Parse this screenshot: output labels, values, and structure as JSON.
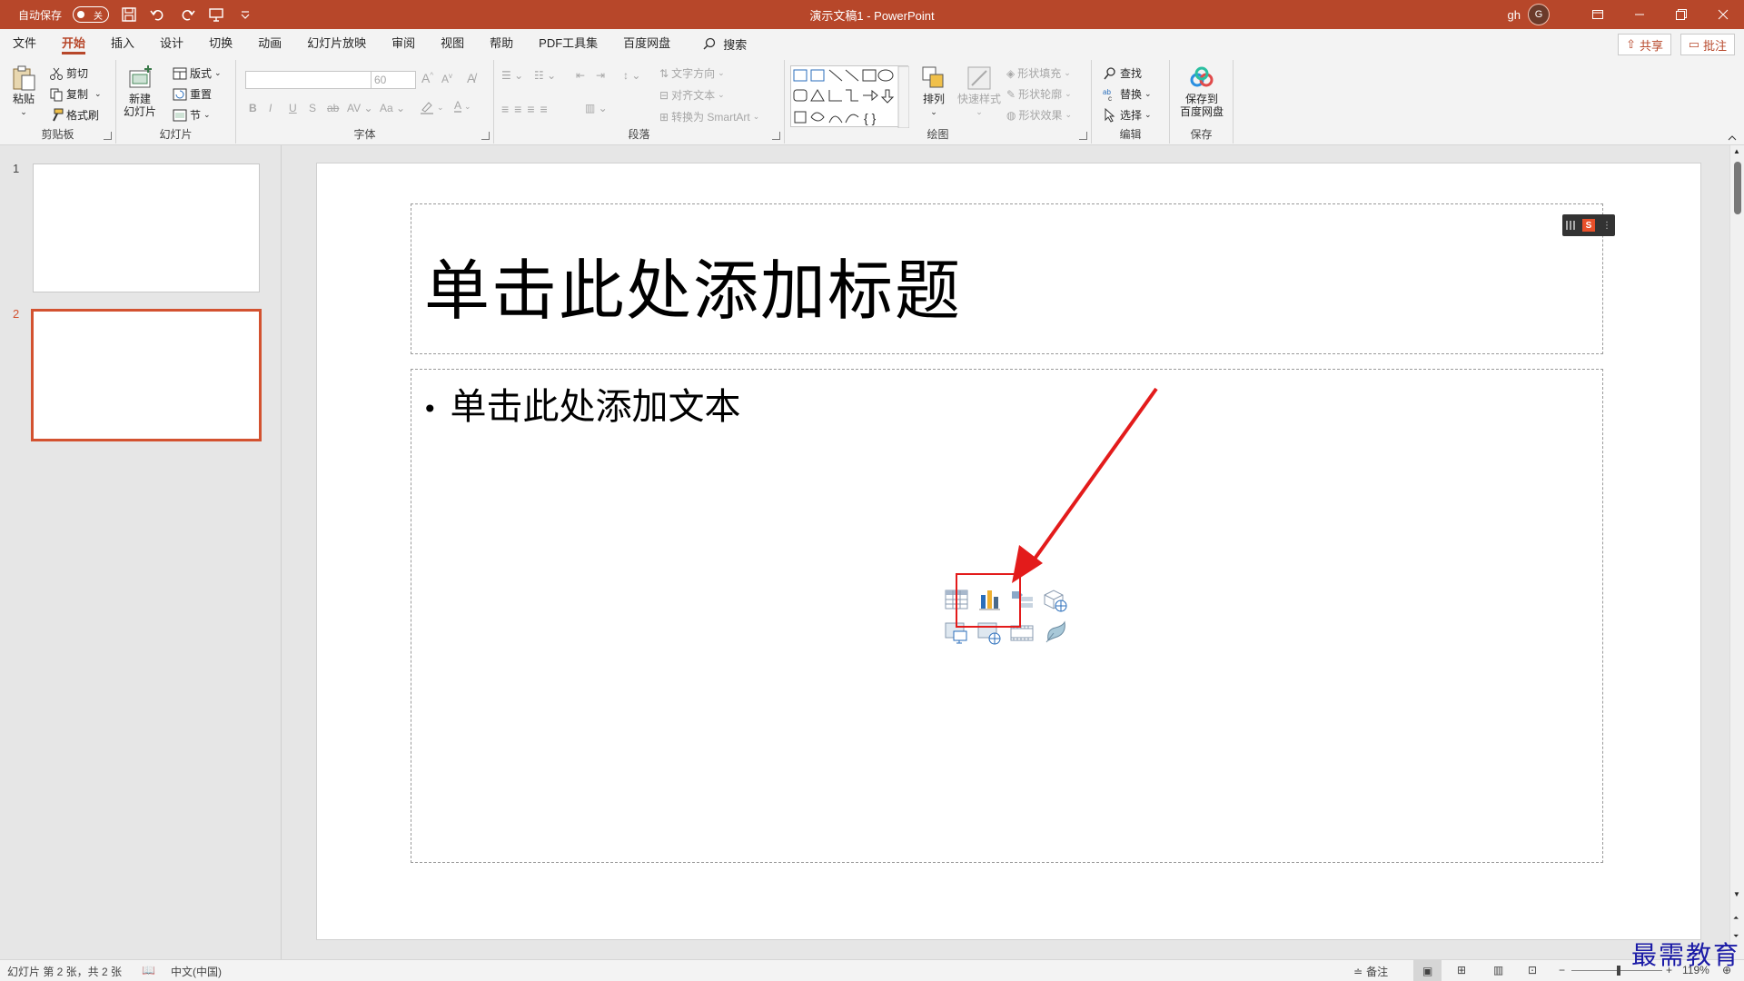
{
  "titlebar": {
    "autosave_label": "自动保存",
    "autosave_state": "关",
    "document_title": "演示文稿1  -  PowerPoint",
    "user_name": "gh",
    "avatar_initial": "G"
  },
  "tabs": [
    {
      "label": "文件",
      "active": false
    },
    {
      "label": "开始",
      "active": true
    },
    {
      "label": "插入",
      "active": false
    },
    {
      "label": "设计",
      "active": false
    },
    {
      "label": "切换",
      "active": false
    },
    {
      "label": "动画",
      "active": false
    },
    {
      "label": "幻灯片放映",
      "active": false
    },
    {
      "label": "审阅",
      "active": false
    },
    {
      "label": "视图",
      "active": false
    },
    {
      "label": "帮助",
      "active": false
    },
    {
      "label": "PDF工具集",
      "active": false
    },
    {
      "label": "百度网盘",
      "active": false
    }
  ],
  "search_label": "搜索",
  "share_label": "共享",
  "comment_label": "批注",
  "ribbon": {
    "clipboard": {
      "label": "剪贴板",
      "paste": "粘贴",
      "cut": "剪切",
      "copy": "复制",
      "format_painter": "格式刷"
    },
    "slides": {
      "label": "幻灯片",
      "new_slide_line1": "新建",
      "new_slide_line2": "幻灯片",
      "layout": "版式",
      "reset": "重置",
      "section": "节"
    },
    "font": {
      "label": "字体",
      "size": "60"
    },
    "paragraph": {
      "label": "段落",
      "text_direction": "文字方向",
      "align_text": "对齐文本",
      "convert_smartart": "转换为 SmartArt"
    },
    "drawing": {
      "label": "绘图",
      "arrange": "排列",
      "quick_styles": "快速样式",
      "shape_fill": "形状填充",
      "shape_outline": "形状轮廓",
      "shape_effects": "形状效果"
    },
    "editing": {
      "label": "编辑",
      "find": "查找",
      "replace": "替换",
      "select": "选择"
    },
    "save": {
      "label": "保存",
      "save_to_line1": "保存到",
      "save_to_line2": "百度网盘"
    }
  },
  "thumbnails": [
    {
      "number": "1",
      "active": false
    },
    {
      "number": "2",
      "active": true
    }
  ],
  "slide": {
    "title_placeholder": "单击此处添加标题",
    "body_placeholder": "单击此处添加文本",
    "bullet": "•"
  },
  "statusbar": {
    "slide_info": "幻灯片 第 2 张，共 2 张",
    "language": "中文(中国)",
    "notes": "备注",
    "zoom": "119%"
  },
  "watermark": "最需教育",
  "colors": {
    "accent": "#b7472a",
    "selection": "#d35230",
    "annotation": "#e31b1b"
  }
}
